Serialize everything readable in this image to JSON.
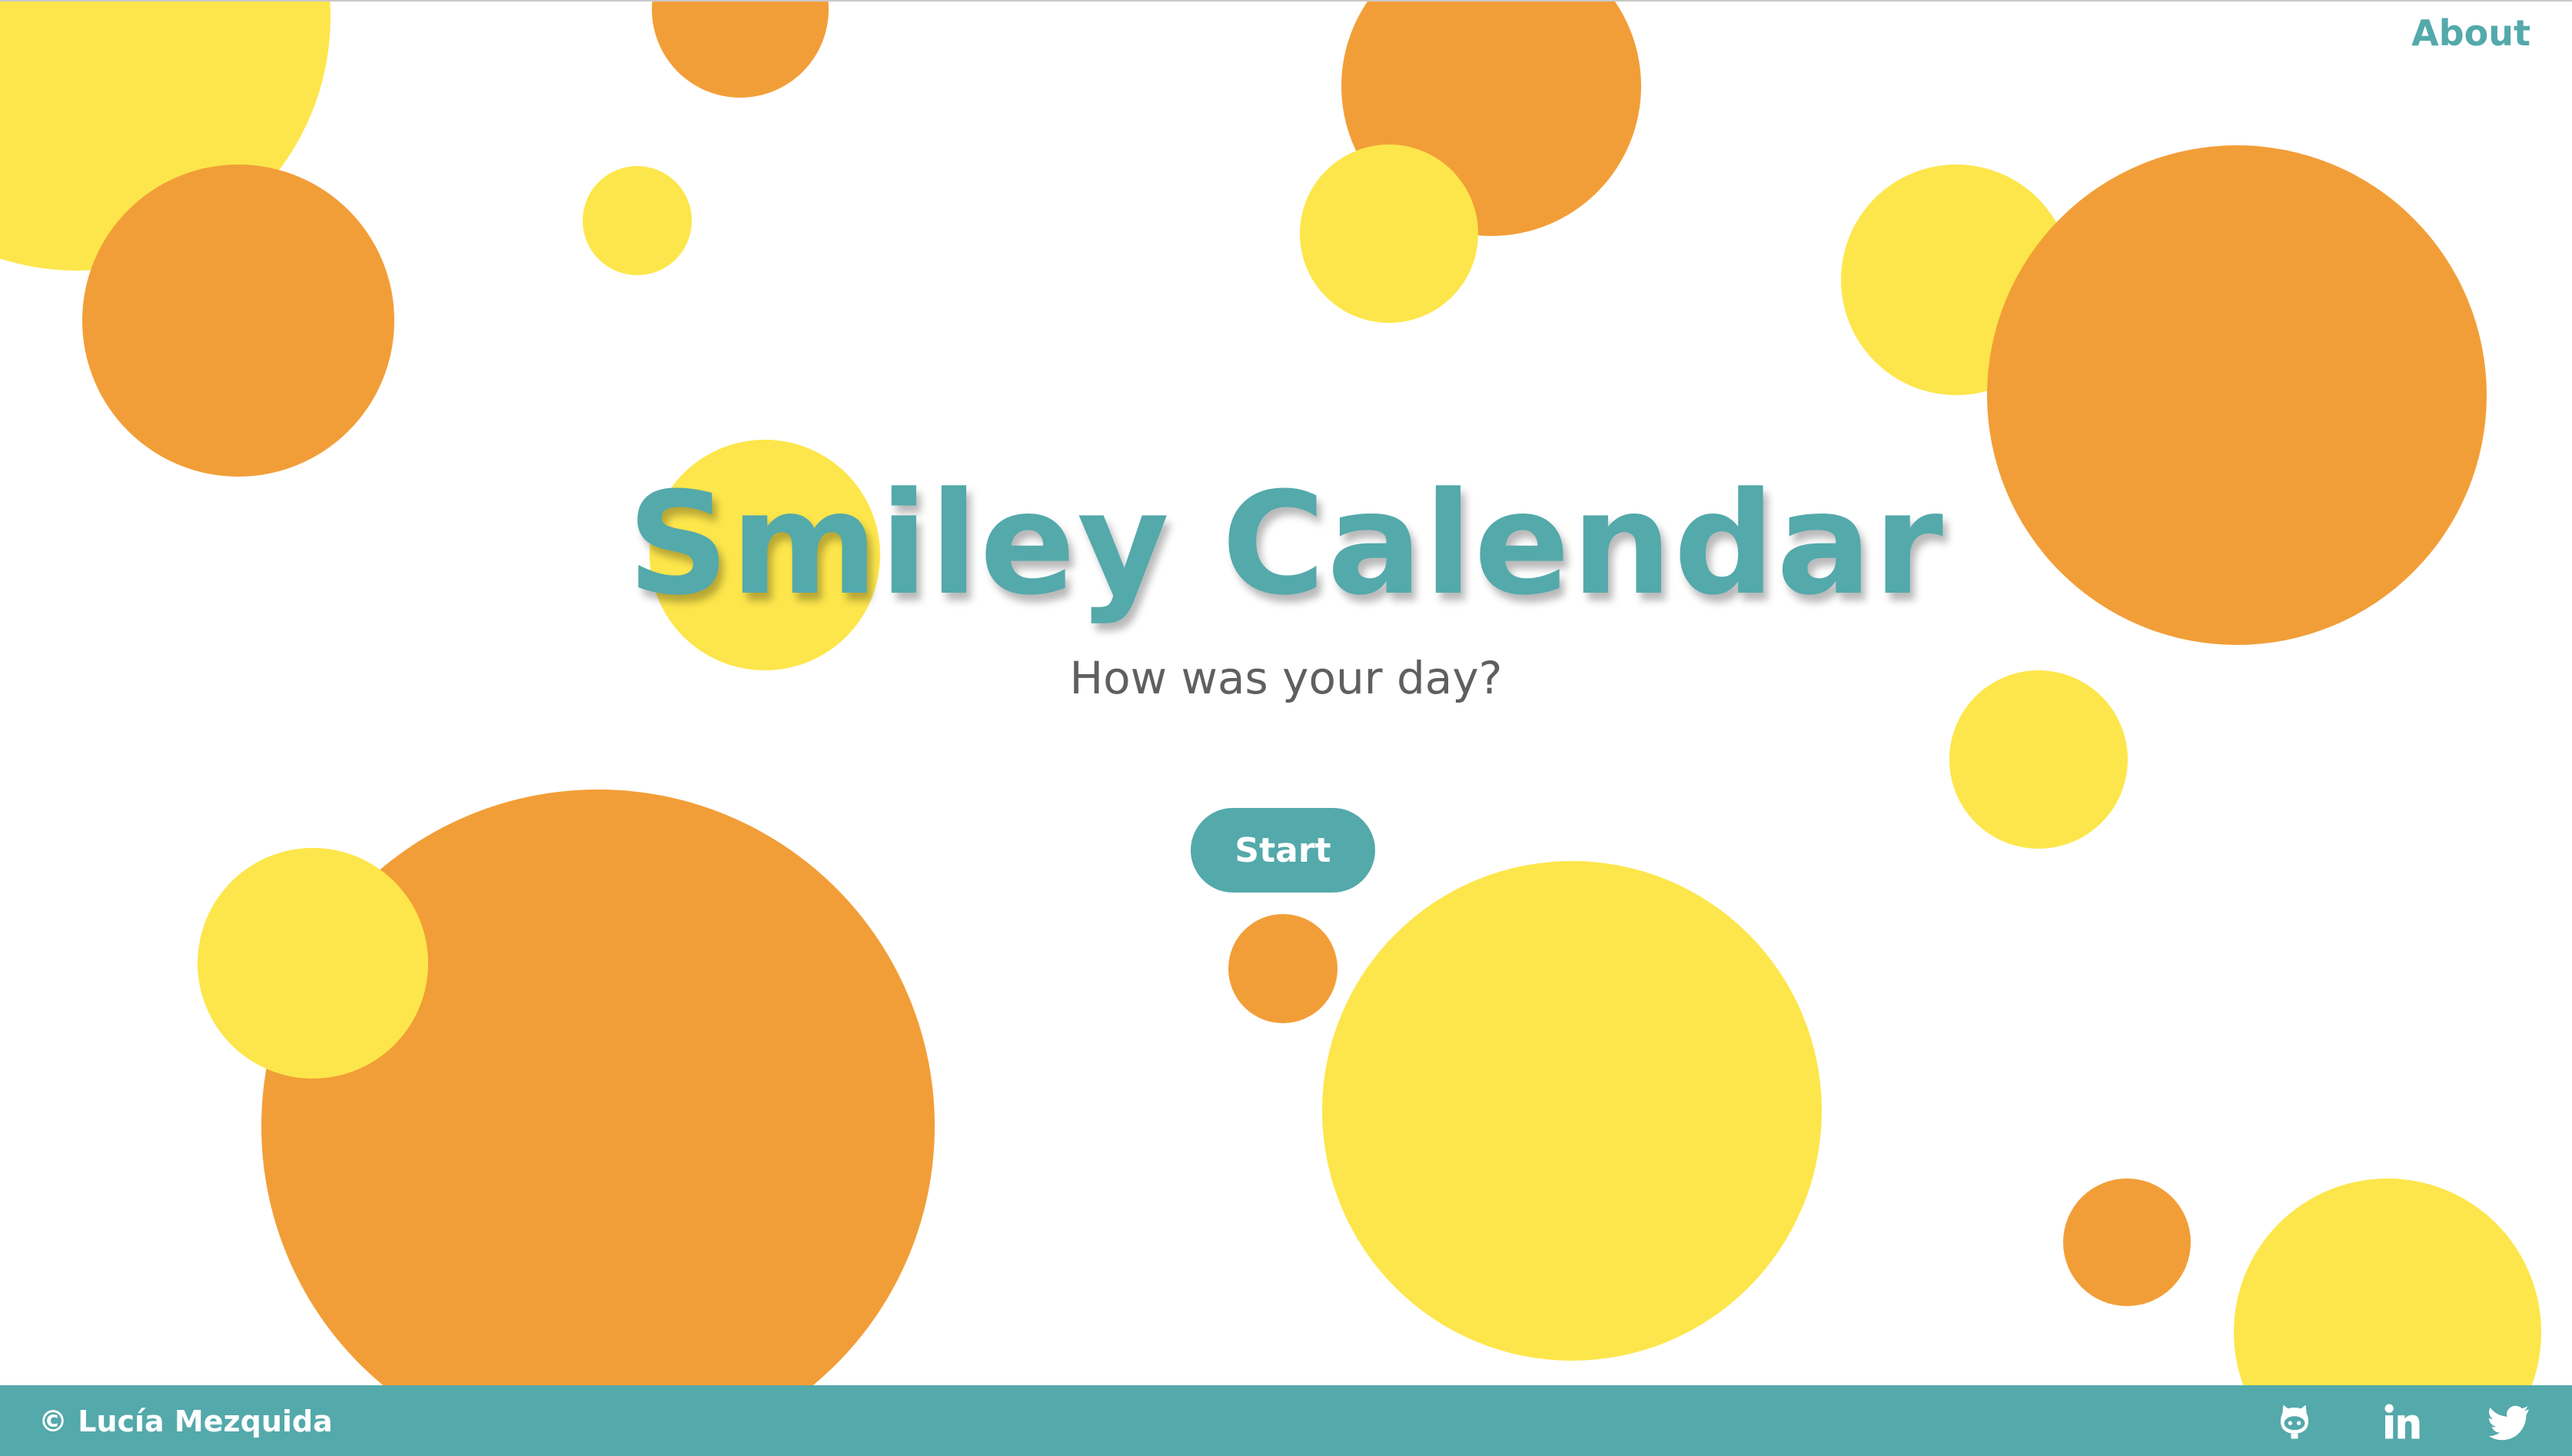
{
  "colors": {
    "teal": "#54a9ab",
    "orange": "#f29e38",
    "yellow": "#fde64b",
    "subtitle_gray": "#5f5f5f",
    "background": "#ffffff"
  },
  "header": {
    "about_label": "About"
  },
  "hero": {
    "title": "Smiley Calendar",
    "subtitle": "How was your day?",
    "start_label": "Start"
  },
  "footer": {
    "copyright": "© Lucía Mezquida",
    "social_icons": [
      "github-icon",
      "linkedin-icon",
      "twitter-icon"
    ]
  }
}
